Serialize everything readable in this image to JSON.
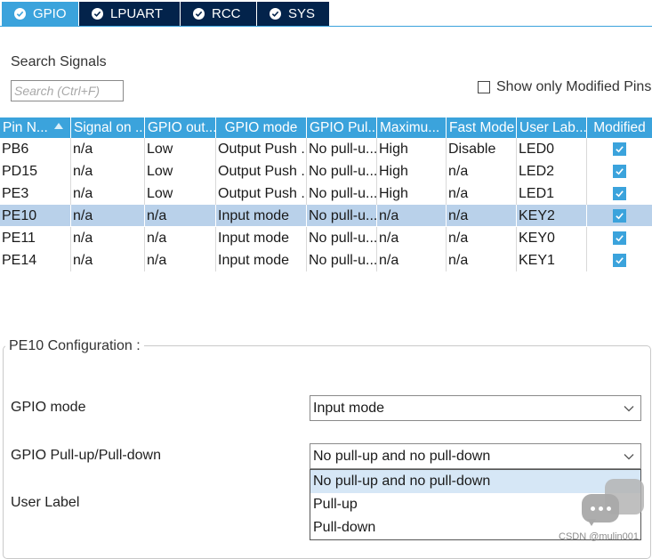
{
  "tabs": [
    {
      "label": "GPIO",
      "active": true
    },
    {
      "label": "LPUART",
      "active": false
    },
    {
      "label": "RCC",
      "active": false
    },
    {
      "label": "SYS",
      "active": false
    }
  ],
  "search": {
    "label": "Search Signals",
    "placeholder": "Search (Ctrl+F)",
    "value": ""
  },
  "filter": {
    "show_modified_label": "Show only Modified Pins",
    "show_modified_checked": false
  },
  "table": {
    "headers": [
      "Pin N...",
      "Signal on ...",
      "GPIO out...",
      "GPIO mode",
      "GPIO Pul...",
      "Maximu...",
      "Fast Mode",
      "User Lab...",
      "Modified"
    ],
    "rows": [
      {
        "pin": "PB6",
        "signal": "n/a",
        "output": "Low",
        "mode": "Output Push ...",
        "pull": "No pull-u...",
        "speed": "High",
        "fast": "Disable",
        "label": "LED0",
        "modified": true,
        "selected": false
      },
      {
        "pin": "PD15",
        "signal": "n/a",
        "output": "Low",
        "mode": "Output Push ...",
        "pull": "No pull-u...",
        "speed": "High",
        "fast": "n/a",
        "label": "LED2",
        "modified": true,
        "selected": false
      },
      {
        "pin": "PE3",
        "signal": "n/a",
        "output": "Low",
        "mode": "Output Push ...",
        "pull": "No pull-u...",
        "speed": "High",
        "fast": "n/a",
        "label": "LED1",
        "modified": true,
        "selected": false
      },
      {
        "pin": "PE10",
        "signal": "n/a",
        "output": "n/a",
        "mode": "Input mode",
        "pull": "No pull-u...",
        "speed": "n/a",
        "fast": "n/a",
        "label": "KEY2",
        "modified": true,
        "selected": true
      },
      {
        "pin": "PE11",
        "signal": "n/a",
        "output": "n/a",
        "mode": "Input mode",
        "pull": "No pull-u...",
        "speed": "n/a",
        "fast": "n/a",
        "label": "KEY0",
        "modified": true,
        "selected": false
      },
      {
        "pin": "PE14",
        "signal": "n/a",
        "output": "n/a",
        "mode": "Input mode",
        "pull": "No pull-u...",
        "speed": "n/a",
        "fast": "n/a",
        "label": "KEY1",
        "modified": true,
        "selected": false
      }
    ]
  },
  "config": {
    "title": "PE10 Configuration :",
    "gpio_mode_label": "GPIO mode",
    "gpio_mode_value": "Input mode",
    "pull_label": "GPIO Pull-up/Pull-down",
    "pull_value": "No pull-up and no pull-down",
    "pull_options": [
      "No pull-up and no pull-down",
      "Pull-up",
      "Pull-down"
    ],
    "user_label_label": "User Label"
  },
  "watermark": "CSDN @mulin001",
  "colors": {
    "accent": "#3ba3dc",
    "tab_dark": "#03234b",
    "selected_row": "#b9d1ea"
  }
}
